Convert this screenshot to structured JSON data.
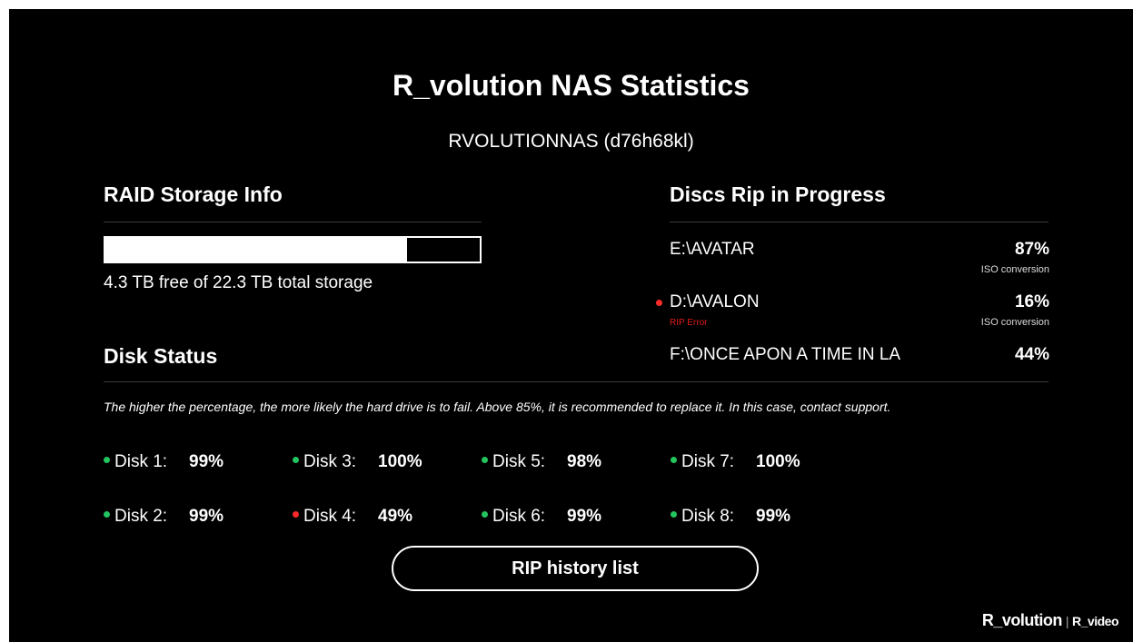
{
  "title": "R_volution NAS Statistics",
  "subtitle": "RVOLUTIONNAS (d76h68kl)",
  "raid": {
    "heading": "RAID Storage Info",
    "used_fraction": 0.807,
    "text": "4.3 TB free of 22.3 TB total storage"
  },
  "disk_status": {
    "heading": "Disk Status",
    "note": "The higher the percentage, the more likely the hard drive is to fail. Above 85%, it is recommended to replace it. In this case, contact support.",
    "disks": [
      {
        "label": "Disk 1:",
        "value": "99%",
        "status_color": "#22c55e"
      },
      {
        "label": "Disk 2:",
        "value": "99%",
        "status_color": "#22c55e"
      },
      {
        "label": "Disk 3:",
        "value": "100%",
        "status_color": "#22c55e"
      },
      {
        "label": "Disk 4:",
        "value": "49%",
        "status_color": "#ff2a2a"
      },
      {
        "label": "Disk 5:",
        "value": "98%",
        "status_color": "#22c55e"
      },
      {
        "label": "Disk 6:",
        "value": "99%",
        "status_color": "#22c55e"
      },
      {
        "label": "Disk 7:",
        "value": "100%",
        "status_color": "#22c55e"
      },
      {
        "label": "Disk 8:",
        "value": "99%",
        "status_color": "#22c55e"
      }
    ]
  },
  "rips": {
    "heading": "Discs Rip in Progress",
    "items": [
      {
        "name": "E:\\AVATAR",
        "percent": "87%",
        "sub": "ISO conversion",
        "error": ""
      },
      {
        "name": "D:\\AVALON",
        "percent": "16%",
        "sub": "ISO conversion",
        "error": "RIP Error"
      },
      {
        "name": "F:\\ONCE APON A TIME IN LA",
        "percent": "44%",
        "sub": "",
        "error": ""
      }
    ]
  },
  "history_button": "RIP history list",
  "brand": {
    "main": "R_volution",
    "sep": "|",
    "secondary": "R_video"
  }
}
